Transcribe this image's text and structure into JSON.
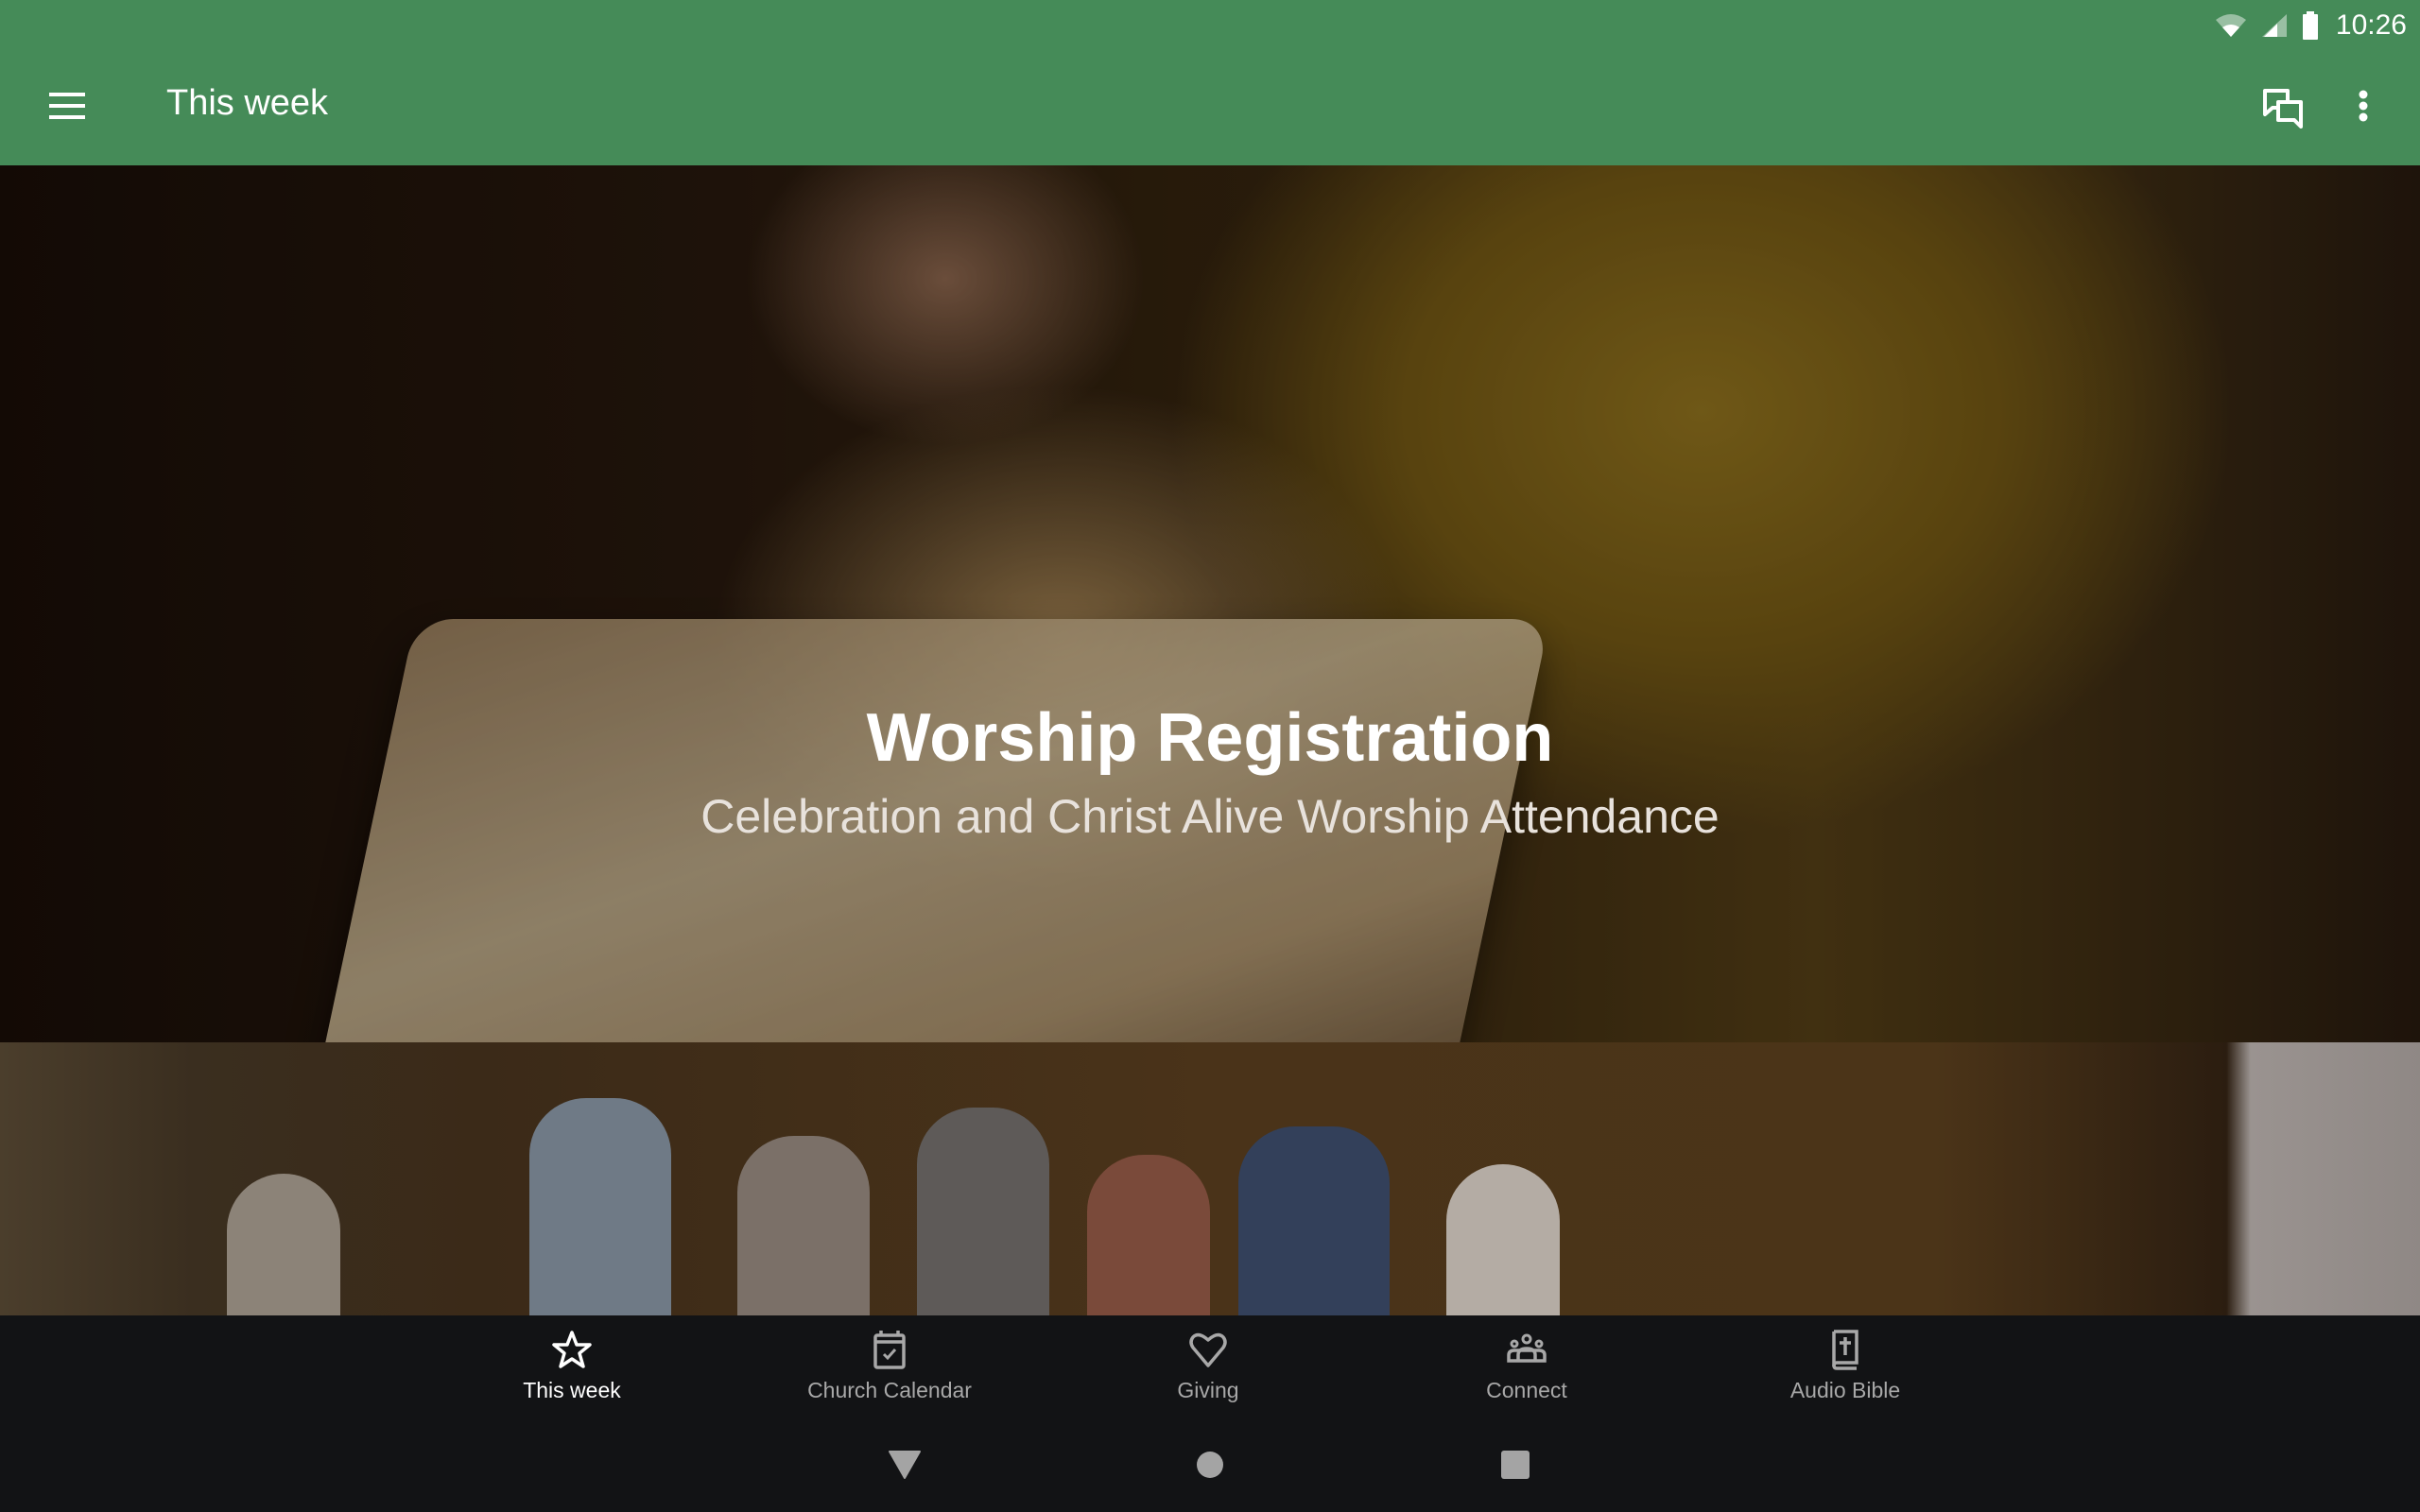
{
  "status_bar": {
    "time": "10:26",
    "icons": [
      "wifi-icon",
      "cell-signal-icon",
      "battery-icon"
    ]
  },
  "app_bar": {
    "title": "This week",
    "menu_icon": "hamburger-menu-icon",
    "actions": [
      {
        "name": "chat",
        "icon": "chat-bubbles-icon"
      },
      {
        "name": "more",
        "icon": "more-vert-icon"
      }
    ],
    "color": "#458b58"
  },
  "hero": {
    "title": "Worship Registration",
    "subtitle": "Celebration and Christ Alive Worship Attendance"
  },
  "bottom_nav": {
    "items": [
      {
        "label": "This week",
        "icon": "star-icon",
        "active": true
      },
      {
        "label": "Church Calendar",
        "icon": "calendar-check-icon",
        "active": false
      },
      {
        "label": "Giving",
        "icon": "heart-icon",
        "active": false
      },
      {
        "label": "Connect",
        "icon": "group-icon",
        "active": false
      },
      {
        "label": "Audio Bible",
        "icon": "bible-icon",
        "active": false
      }
    ],
    "active_color": "#ffffff",
    "inactive_color": "#a8a8a8"
  },
  "system_nav": {
    "buttons": [
      "back",
      "home",
      "recents"
    ]
  }
}
